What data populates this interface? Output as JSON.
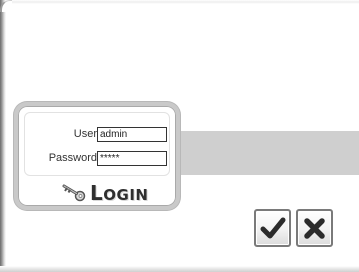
{
  "login_form": {
    "user_label": "User",
    "user_value": "admin",
    "password_label": "Password",
    "password_value": "*****",
    "login_button_first": "L",
    "login_button_rest": "OGIN"
  },
  "dialog_buttons": {
    "ok_icon": "checkmark-icon",
    "cancel_icon": "close-x-icon"
  },
  "colors": {
    "band": "#cfcfcf",
    "panel_border": "#c9c9c9",
    "icon_dark": "#2b2b2b"
  }
}
